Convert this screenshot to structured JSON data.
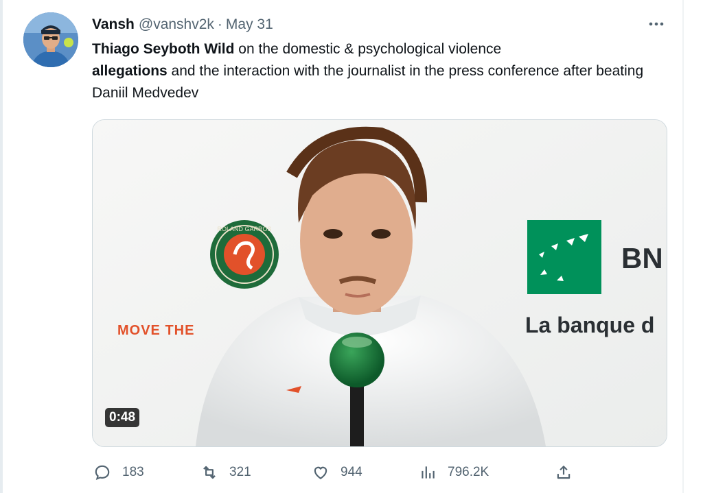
{
  "tweet": {
    "author": {
      "display_name": "Vansh",
      "handle": "@vanshv2k",
      "separator": "·",
      "date": "May 31"
    },
    "text": {
      "bold1": "Thiago Seyboth Wild",
      "part1": " on the domestic & psychological violence",
      "bold2": "allegations",
      "part2": " and the interaction with the journalist in the press conference after beating Daniil Medvedev"
    },
    "media": {
      "duration": "0:48",
      "logos": {
        "move_the": "MOVE THE",
        "bnp": "BN",
        "banque": "La banque d"
      }
    },
    "actions": {
      "reply": {
        "icon": "reply-icon",
        "count": "183"
      },
      "retweet": {
        "icon": "retweet-icon",
        "count": "321"
      },
      "like": {
        "icon": "heart-icon",
        "count": "944"
      },
      "views": {
        "icon": "views-icon",
        "count": "796.2K"
      },
      "share": {
        "icon": "share-icon"
      }
    },
    "colors": {
      "text": "#0f1419",
      "secondary": "#536471",
      "rg_green": "#1e6b3a",
      "rg_orange": "#e2512a",
      "bnp_green": "#00915a"
    }
  }
}
